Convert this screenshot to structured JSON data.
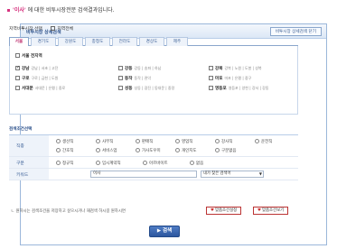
{
  "headline": {
    "quote": "'이사'",
    "rest": " 에 대한 비투시장전문 검색결과입니다."
  },
  "panel": {
    "title": "비투시장 상세검색",
    "toggle_label": "비투시장 상세검색 닫기"
  },
  "region_bar": {
    "label": "지역비투시장 선택",
    "all_label": "지역전체"
  },
  "tabs": [
    "서울",
    "경기도",
    "강원도",
    "충청도",
    "전라도",
    "경상도",
    "제주"
  ],
  "active_tab": "서울",
  "regions": [
    {
      "name": "서울 전지역",
      "sub": "",
      "checked": false
    },
    {
      "name": "강남",
      "sub": "강남 | 서초 | 고잔",
      "checked": true
    },
    {
      "name": "강동",
      "sub": "강동 | 송파 | 하남",
      "checked": false
    },
    {
      "name": "강북",
      "sub": "강북 | 노원 | 도봉 | 성북",
      "checked": false
    },
    {
      "name": "구로",
      "sub": "구로 | 금천 | 도원",
      "checked": false
    },
    {
      "name": "동작",
      "sub": "동작 | 관악",
      "checked": false
    },
    {
      "name": "마포",
      "sub": "마포 | 은평 | 중구",
      "checked": false
    },
    {
      "name": "서대문",
      "sub": "서대문 | 은평 | 중로",
      "checked": false
    },
    {
      "name": "성동",
      "sub": "성동 | 광진 | 동대문 | 중랑",
      "checked": false
    },
    {
      "name": "영등포",
      "sub": "영등포 | 양천 | 강서 | 강동",
      "checked": false
    }
  ],
  "conditions": {
    "title": "검색조건선택",
    "job": {
      "label": "직종",
      "options": [
        "생산직",
        "사무직",
        "판매직",
        "영업직",
        "강사직",
        "운전직",
        "간호직",
        "서비스업",
        "가사도우미",
        "개인지도",
        "구분없음"
      ]
    },
    "type": {
      "label": "구분",
      "options": [
        "정규직",
        "임시계약직",
        "아르바이트",
        "없음"
      ]
    },
    "keyword": {
      "label": "키워드",
      "value": "이사",
      "select_value": "내가 찾은 검색어"
    }
  },
  "save_row": {
    "text": "원하시는 검색조건을 저장하고 싶으시거나 재검색 하시길 원하시면",
    "save_button": "맞춤조건설정",
    "view_button": "맞춤조건보기"
  },
  "search_button": "검색"
}
